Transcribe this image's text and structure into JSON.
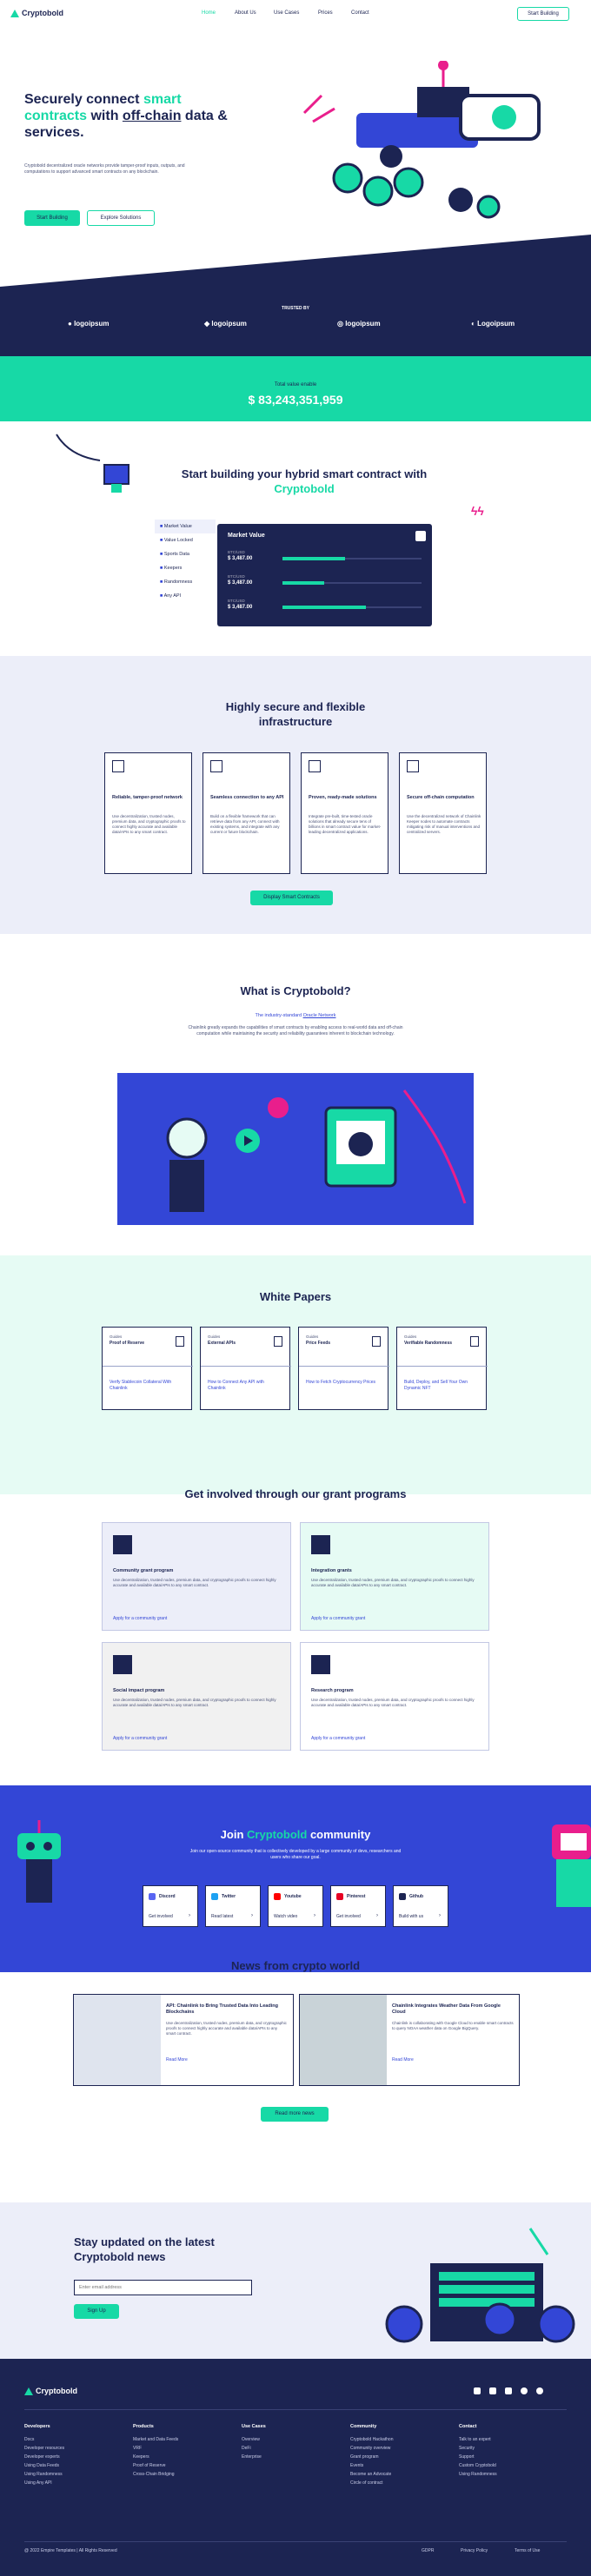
{
  "brand": "Cryptobold",
  "nav": {
    "items": [
      "Home",
      "About Us",
      "Use Cases",
      "Prices",
      "Contact"
    ],
    "cta": "Start Building"
  },
  "hero": {
    "title_a": "Securely connect ",
    "title_b": "smart contracts",
    "title_c": " with ",
    "title_d": "off-chain",
    "title_e": " data & services.",
    "desc": "Cryptobold decentralized oracle networks provide tamper-proof inputs, outputs, and computations to support advanced smart contracts on any blockchain.",
    "primary": "Start Building",
    "secondary": "Explore Solutions"
  },
  "trusted": {
    "label": "TRUSTED BY",
    "logos": [
      "logoipsum",
      "logoipsum",
      "logoipsum",
      "Logoipsum"
    ]
  },
  "stats": {
    "label": "Total value enable",
    "value": "$ 83,243,351,959"
  },
  "build": {
    "title_a": "Start building your hybrid smart contract with ",
    "title_b": "Cryptobold",
    "tabs": [
      "Market Value",
      "Value Locked",
      "Sports Data",
      "Keepers",
      "Randomness",
      "Any API"
    ],
    "panel_title": "Market Value",
    "rows": [
      {
        "label": "BTC/USD",
        "value": "$ 3,487.00"
      },
      {
        "label": "BTC/USD",
        "value": "$ 3,487.00"
      },
      {
        "label": "BTC/USD",
        "value": "$ 3,487.00"
      }
    ],
    "progress": [
      0.45,
      0.3,
      0.6
    ]
  },
  "secure": {
    "title": "Highly secure and flexible infrastructure",
    "cards": [
      {
        "title": "Reliable, tamper-proof network",
        "desc": "Use decentralization, trusted nodes, premium data, and cryptographic proofs to connect highly accurate and available data/APIs to any smart contract."
      },
      {
        "title": "Seamless connection to any API",
        "desc": "Build on a flexible framework that can retrieve data from any API, connect with existing systems, and integrate with any current or future blockchain."
      },
      {
        "title": "Proven, ready-made solutions",
        "desc": "Integrate pre-built, time-tested oracle solutions that already secure tens of billions in smart contract value for market-leading decentralized applications."
      },
      {
        "title": "Secure off-chain computation",
        "desc": "Use the decentralized network of Chainlink Keeper nodes to automate contracts mitigating risk of manual interventions and centralized servers."
      }
    ],
    "cta": "Display Smart Contracts"
  },
  "what": {
    "title": "What is Cryptobold?",
    "subtitle_a": "The industry-standard ",
    "subtitle_b": "Oracle Network",
    "desc": "Chainlink greatly expands the capabilities of smart contracts by enabling access to real-world data and off-chain computation while maintaining the security and reliability guarantees inherent to blockchain technology."
  },
  "papers": {
    "title": "White Papers",
    "cards": [
      {
        "kicker": "Guides",
        "title": "Proof of Reserve",
        "link": "Verify Stablecoin Collateral With Chainlink"
      },
      {
        "kicker": "Guides",
        "title": "External APIs",
        "link": "How to Connect Any API with Chainlink"
      },
      {
        "kicker": "Guides",
        "title": "Price Feeds",
        "link": "How to Fetch Cryptocurrency Prices"
      },
      {
        "kicker": "Guides",
        "title": "Verifiable Randomness",
        "link": "Build, Deploy, and Sell Your Own Dynamic NFT"
      }
    ]
  },
  "grants": {
    "title": "Get involved through our grant programs",
    "cards": [
      {
        "title": "Community grant program",
        "desc": "Use decentralization, trusted nodes, premium data, and cryptographic proofs to connect highly accurate and available data/APIs to any smart contract.",
        "link": "Apply for a community grant"
      },
      {
        "title": "Integration grants",
        "desc": "Use decentralization, trusted nodes, premium data, and cryptographic proofs to connect highly accurate and available data/APIs to any smart contract.",
        "link": "Apply for a community grant"
      },
      {
        "title": "Social impact program",
        "desc": "Use decentralization, trusted nodes, premium data, and cryptographic proofs to connect highly accurate and available data/APIs to any smart contract.",
        "link": "Apply for a community grant"
      },
      {
        "title": "Research program",
        "desc": "Use decentralization, trusted nodes, premium data, and cryptographic proofs to connect highly accurate and available data/APIs to any smart contract.",
        "link": "Apply for a community grant"
      }
    ]
  },
  "community": {
    "title_a": "Join ",
    "title_b": "Cryptobold",
    "title_c": " community",
    "desc": "Join our open-source community that is collectively developed by a large community of devs, researchers and users who share our goal.",
    "items": [
      {
        "name": "Discord",
        "cta": "Get involved"
      },
      {
        "name": "Twitter",
        "cta": "Read latest"
      },
      {
        "name": "Youtube",
        "cta": "Watch video"
      },
      {
        "name": "Pinterest",
        "cta": "Get involved"
      },
      {
        "name": "Github",
        "cta": "Build with us"
      }
    ]
  },
  "news": {
    "title": "News from crypto world",
    "cards": [
      {
        "title": "API: Chainlink to Bring Trusted Data Into Leading Blockchains",
        "desc": "Use decentralization, trusted nodes, premium data, and cryptographic proofs to connect highly accurate and available data/APIs to any smart contract.",
        "link": "Read More"
      },
      {
        "title": "Chainlink Integrates Weather Data From Google Cloud",
        "desc": "Chainlink is collaborating with Google Cloud to enable smart contracts to query NOAA weather data on Google BigQuery.",
        "link": "Read More"
      }
    ],
    "cta": "Read more news"
  },
  "newsletter": {
    "title": "Stay updated on the latest Cryptobold news",
    "placeholder": "Enter email address",
    "button": "Sign Up"
  },
  "footer": {
    "brand": "Cryptobold",
    "cols": [
      {
        "h": "Developers",
        "items": [
          "Docs",
          "Developer resources",
          "Developer experts",
          "Using Data Feeds",
          "Using Randomness",
          "Using Any API"
        ]
      },
      {
        "h": "Products",
        "items": [
          "Market and Data Feeds",
          "VRF",
          "Keepers",
          "Proof of Reserve",
          "Cross-Chain Bridging"
        ]
      },
      {
        "h": "Use Cases",
        "items": [
          "Overview",
          "DeFi",
          "Enterprise"
        ]
      },
      {
        "h": "Community",
        "items": [
          "Cryptobold Hackathon",
          "Community overview",
          "Grant program",
          "Events",
          "Become an Advocate",
          "Circle of contract"
        ]
      },
      {
        "h": "Contact",
        "items": [
          "Talk to an expert",
          "Security",
          "Support",
          "Custom Cryptobold",
          "Using Randomness"
        ]
      }
    ],
    "copyright": "@ 2022 Empire Templates | All Rights Reserved",
    "legal": [
      "GDPR",
      "Privacy Policy",
      "Terms of Use"
    ]
  },
  "colors": {
    "navy": "#1c2452",
    "green": "#17d9a6",
    "blue": "#3346d6",
    "lavender": "#eceef9",
    "mint": "#e6fbf4"
  }
}
